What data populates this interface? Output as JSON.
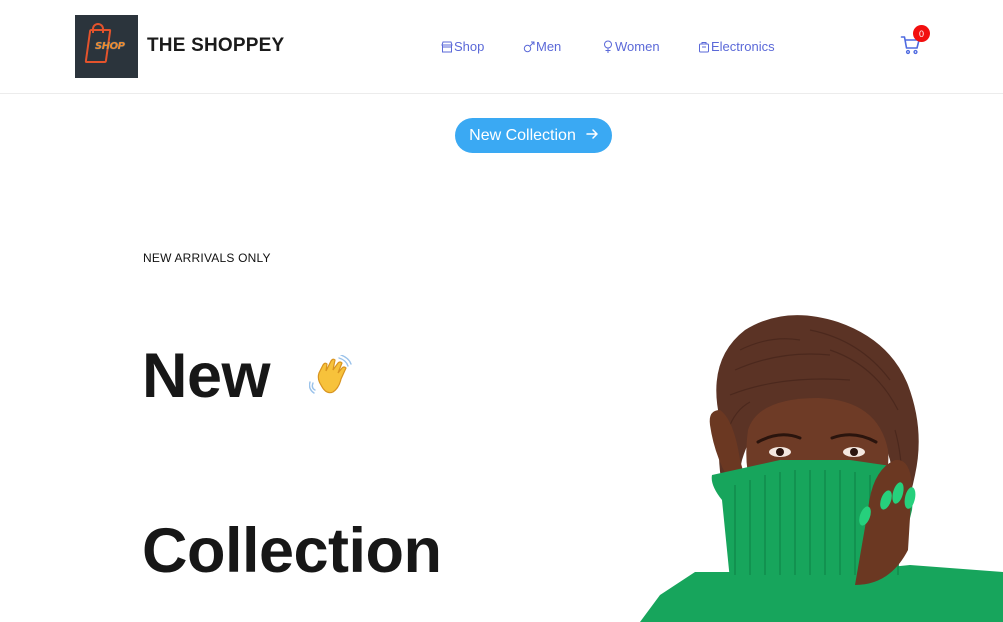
{
  "header": {
    "brand": "THE SHOPPEY",
    "logo_text": "SHOP",
    "nav": [
      {
        "label": "Shop",
        "icon": "store-icon"
      },
      {
        "label": "Men",
        "icon": "male-symbol-icon"
      },
      {
        "label": "Women",
        "icon": "female-symbol-icon"
      },
      {
        "label": "Electronics",
        "icon": "device-icon"
      }
    ],
    "cart_count": "0"
  },
  "hero": {
    "button_label": "New Collection",
    "button_icon": "arrow-right-icon",
    "eyebrow": "NEW ARRIVALS ONLY",
    "headline_line1": "New",
    "headline_line2": "Collection",
    "wave_icon": "waving-hand-icon"
  },
  "colors": {
    "nav_link": "#5b69d8",
    "button": "#3aa9f3",
    "badge": "#f20f0f",
    "sweater": "#17a55c"
  }
}
